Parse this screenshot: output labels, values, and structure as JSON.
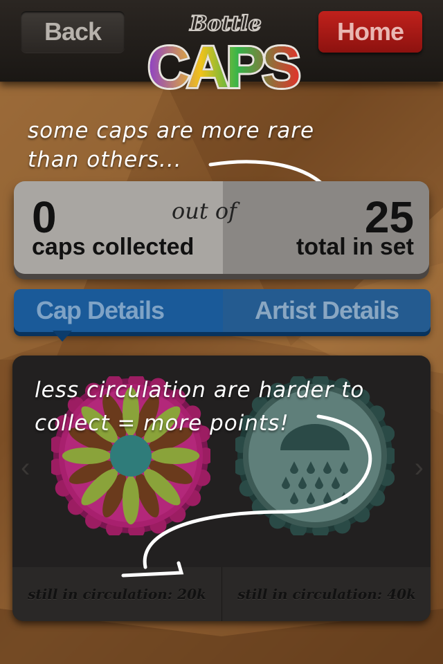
{
  "nav": {
    "back_label": "Back",
    "home_label": "Home"
  },
  "logo": {
    "line1": "Bottle",
    "line2": "CAPS"
  },
  "annotations": {
    "rare_note_line1": "some caps are more rare",
    "rare_note_line2": "than others...",
    "circulation_note_line1": "less circulation are harder to",
    "circulation_note_line2": "collect = more points!"
  },
  "stats": {
    "collected_count": "0",
    "collected_label": "caps collected",
    "separator": "out of",
    "total_count": "25",
    "total_label": "total in set"
  },
  "tabs": [
    {
      "label": "Cap Details",
      "active": true
    },
    {
      "label": "Artist Details",
      "active": false
    }
  ],
  "caps": [
    {
      "icon": "flower-icon",
      "circulation": "still in circulation: 20k",
      "color": "#a8206e"
    },
    {
      "icon": "rain-cloud-icon",
      "circulation": "still in circulation: 40k",
      "color": "#3d5a55"
    }
  ],
  "colors": {
    "accent_blue": "#1a5a99",
    "home_red": "#b51d18",
    "topbar": "#221e1b"
  }
}
